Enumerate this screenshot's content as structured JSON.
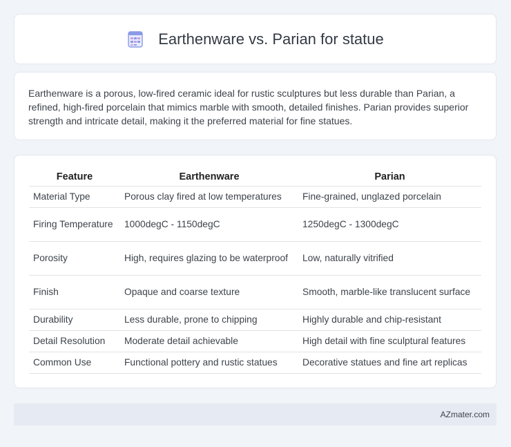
{
  "header": {
    "title": "Earthenware vs. Parian for statue",
    "icon": "document-grid-icon"
  },
  "summary": {
    "text": "Earthenware is a porous, low-fired ceramic ideal for rustic sculptures but less durable than Parian, a refined, high-fired porcelain that mimics marble with smooth, detailed finishes. Parian provides superior strength and intricate detail, making it the preferred material for fine statues."
  },
  "table": {
    "headers": [
      "Feature",
      "Earthenware",
      "Parian"
    ],
    "rows": [
      [
        "Material Type",
        "Porous clay fired at low temperatures",
        "Fine-grained, unglazed porcelain"
      ],
      [
        "Firing Temperature",
        "1000degC - 1150degC",
        "1250degC - 1300degC"
      ],
      [
        "Porosity",
        "High, requires glazing to be waterproof",
        "Low, naturally vitrified"
      ],
      [
        "Finish",
        "Opaque and coarse texture",
        "Smooth, marble-like translucent surface"
      ],
      [
        "Durability",
        "Less durable, prone to chipping",
        "Highly durable and chip-resistant"
      ],
      [
        "Detail Resolution",
        "Moderate detail achievable",
        "High detail with fine sculptural features"
      ],
      [
        "Common Use",
        "Functional pottery and rustic statues",
        "Decorative statues and fine art replicas"
      ]
    ]
  },
  "footer": {
    "text": "AZmater.com"
  },
  "colors": {
    "background": "#f1f4f8",
    "card": "#ffffff",
    "footer": "#e6ebf3",
    "icon_accent": "#7b8fe0"
  }
}
